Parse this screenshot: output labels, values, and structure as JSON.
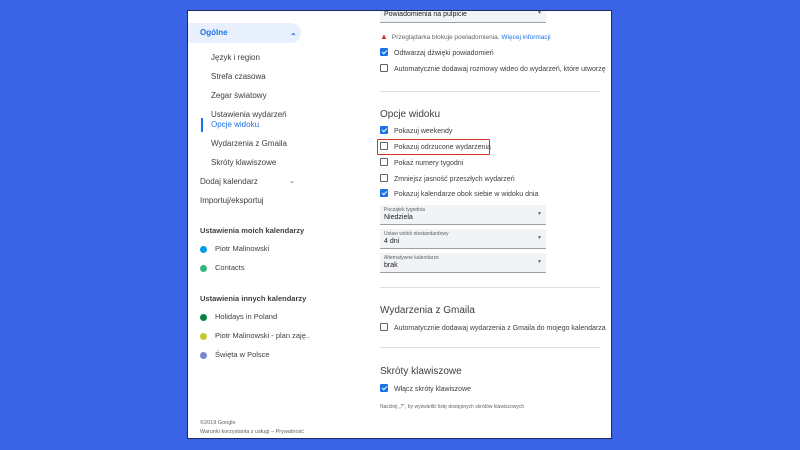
{
  "sidebar": {
    "active_section": "Ogólne",
    "items": [
      "Język i region",
      "Strefa czasowa",
      "Zegar światowy",
      "Ustawienia wydarzeń",
      "Opcje widoku",
      "Wydarzenia z Gmaila",
      "Skróty klawiszowe"
    ],
    "add_calendar": "Dodaj kalendarz",
    "import_export": "Importuj/eksportuj",
    "my_calendars_title": "Ustawienia moich kalendarzy",
    "my_calendars": [
      {
        "name": "Piotr Malinowski",
        "color": "#039be5"
      },
      {
        "name": "Contacts",
        "color": "#33b679"
      }
    ],
    "other_calendars_title": "Ustawienia innych kalendarzy",
    "other_calendars": [
      {
        "name": "Holidays in Poland",
        "color": "#0b8043"
      },
      {
        "name": "Piotr Malinowski - plan zaję..",
        "color": "#c0ca33"
      },
      {
        "name": "Święta w Polsce",
        "color": "#7986cb"
      }
    ],
    "footer_copyright": "©2019 Google",
    "footer_links": "Warunki korzystania z usługi – Prywatność"
  },
  "main": {
    "notif_select_value": "Powiadomienia na pulpicie",
    "warning_text": "Przeglądarka blokuje powiadomienia.",
    "warning_link": "Więcej informacji",
    "notif_options": [
      {
        "label": "Odtwarzaj dźwięki powiadomień",
        "checked": true
      },
      {
        "label": "Automatycznie dodawaj rozmowy wideo do wydarzeń, które utworzę",
        "checked": false
      }
    ],
    "view_title": "Opcje widoku",
    "view_options": [
      {
        "label": "Pokazuj weekendy",
        "checked": true
      },
      {
        "label": "Pokazuj odrzucone wydarzenia",
        "checked": false
      },
      {
        "label": "Pokaż numery tygodni",
        "checked": false
      },
      {
        "label": "Zmniejsz jasność przeszłych wydarzeń",
        "checked": false
      },
      {
        "label": "Pokazuj kalendarze obok siebie w widoku dnia",
        "checked": true
      }
    ],
    "week_start": {
      "label": "Początek tygodnia",
      "value": "Niedziela"
    },
    "custom_view": {
      "label": "Ustaw widok niestandardowy",
      "value": "4 dni"
    },
    "alt_calendars": {
      "label": "Alternatywne kalendarze",
      "value": "brak"
    },
    "gmail_title": "Wydarzenia z Gmaila",
    "gmail_option": {
      "label": "Automatycznie dodawaj wydarzenia z Gmaila do mojego kalendarza",
      "checked": false
    },
    "shortcuts_title": "Skróty klawiszowe",
    "shortcuts_option": {
      "label": "Włącz skróty klawiszowe",
      "checked": true
    },
    "shortcuts_hint": "Naciśnij „?”, by wyświetlić listę dostępnych skrótów klawiszowych"
  }
}
